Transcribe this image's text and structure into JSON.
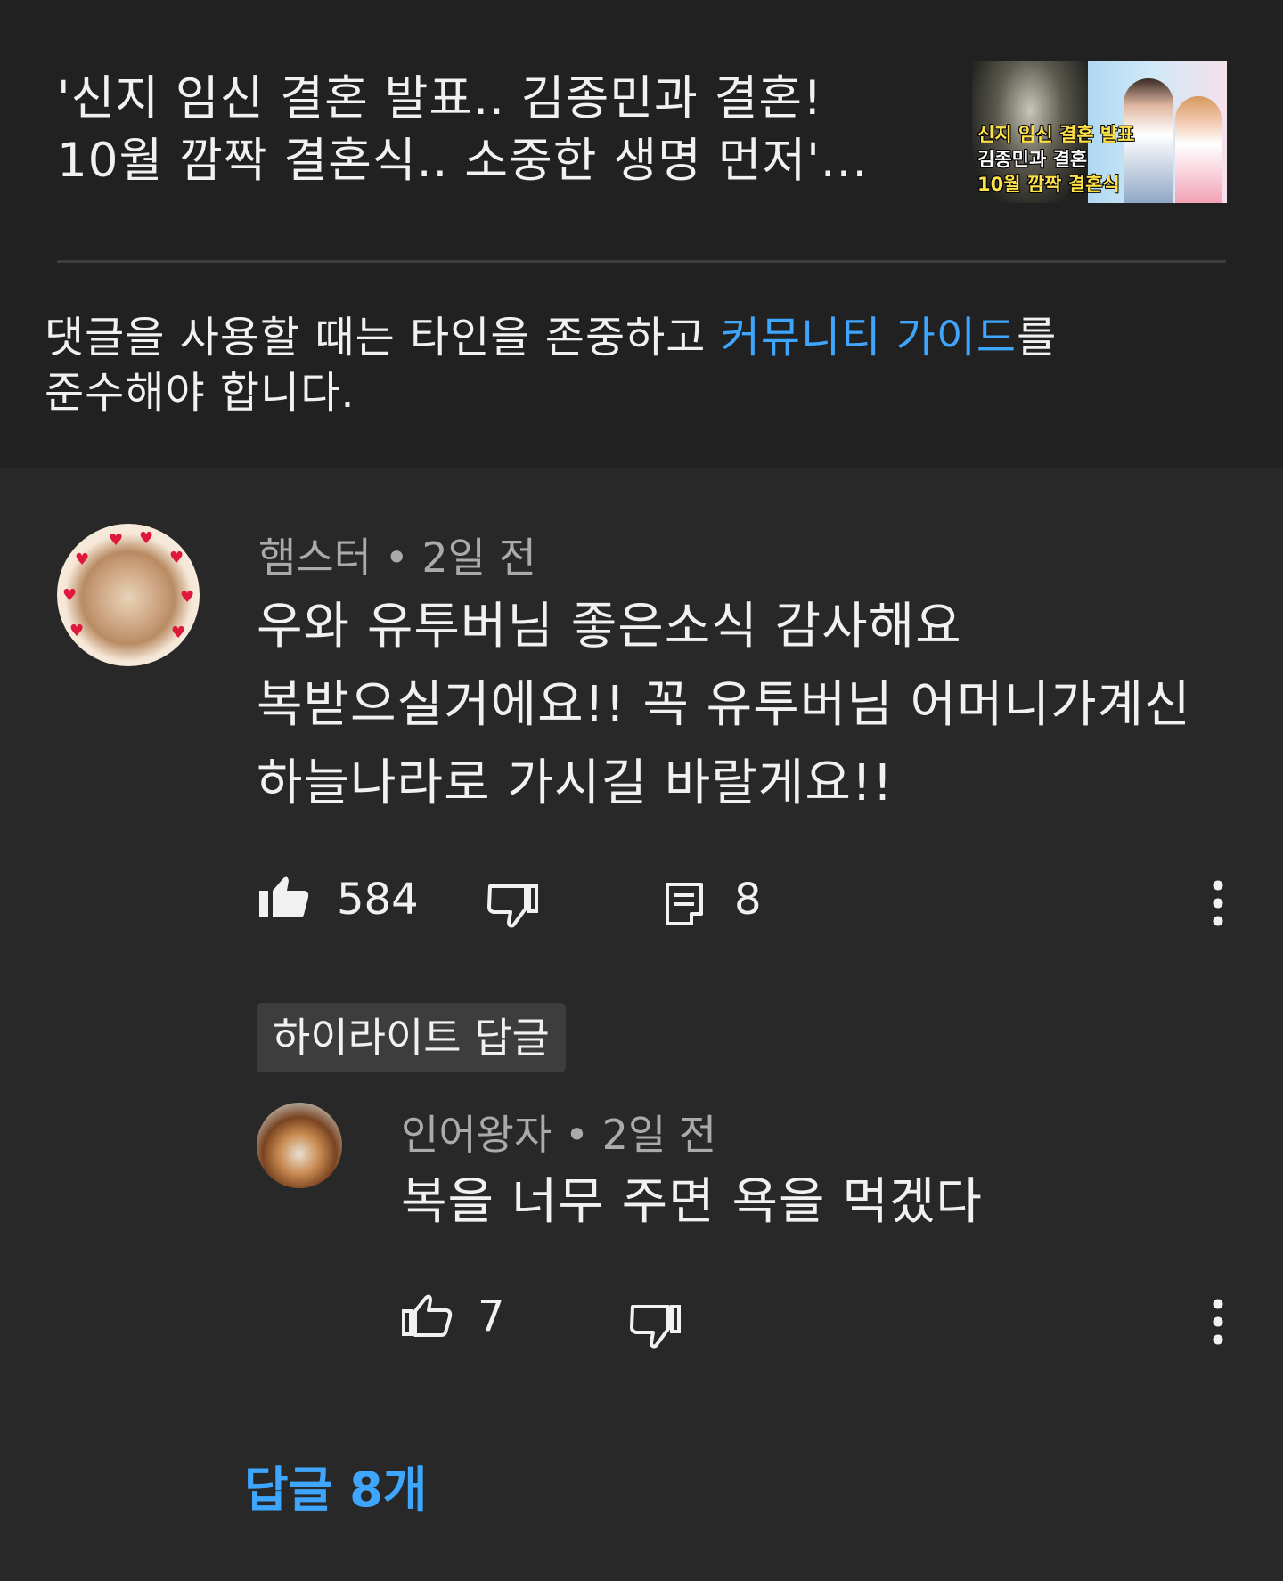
{
  "video": {
    "title_line1": "'신지 임신 결혼 발표.. 김종민과 결혼!",
    "title_line2": "10월 깜짝 결혼식.. 소중한 생명 먼저'...",
    "thumbnail_line1": "신지 임신 결혼 발표",
    "thumbnail_line2": "김종민과 결혼",
    "thumbnail_line3": "10월 깜짝 결혼식"
  },
  "guideline": {
    "text_before": "댓글을 사용할 때는 타인을 존중하고 ",
    "link": "커뮤니티 가이드",
    "text_after_line1": "를",
    "text_line2": "준수해야 합니다."
  },
  "comment": {
    "author": "햄스터",
    "time": "2일 전",
    "text_line1": "우와 유투버님 좋은소식 감사해요",
    "text_line2": "복받으실거에요!! 꼭 유투버님 어머니가계신",
    "text_line3": "하늘나라로 가시길 바랄게요!!",
    "likes": "584",
    "replies": "8"
  },
  "highlight_label": "하이라이트 답글",
  "reply": {
    "author": "인어왕자",
    "time": "2일 전",
    "text": "복을 너무 주면 욕을 먹겠다",
    "likes": "7"
  },
  "replies_link": "답글 8개",
  "icons": {
    "like_filled": "thumb-up-filled-icon",
    "dislike": "thumb-down-outline-icon",
    "reply": "comment-icon",
    "more": "more-vertical-icon",
    "like_outline": "thumb-up-outline-icon"
  },
  "colors": {
    "background_top": "#212121",
    "background_comments": "#282828",
    "link": "#3ea6ff",
    "meta_text": "#aaaaaa"
  }
}
